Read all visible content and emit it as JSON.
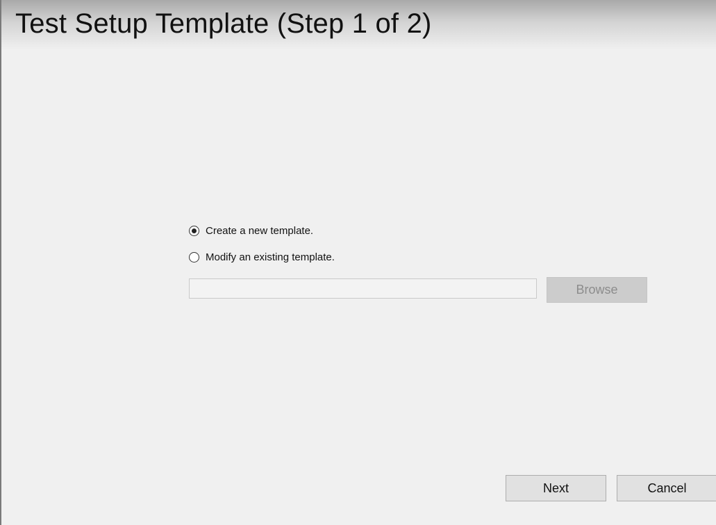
{
  "window": {
    "title": "Test Setup Template (Step 1 of 2)"
  },
  "options": {
    "create_new": {
      "label": "Create a new template.",
      "selected": true
    },
    "modify_existing": {
      "label": "Modify an existing template.",
      "selected": false
    }
  },
  "template_path": {
    "value": "",
    "placeholder": ""
  },
  "buttons": {
    "browse": {
      "label": "Browse",
      "enabled": false
    },
    "next": {
      "label": "Next",
      "enabled": true
    },
    "cancel": {
      "label": "Cancel",
      "enabled": true
    }
  },
  "colors": {
    "background": "#f0f0f0",
    "title_gradient_top": "#a9a9a9",
    "disabled_button": "#cccccc",
    "disabled_text": "#8c8c8c",
    "button_face": "#e1e1e1"
  }
}
